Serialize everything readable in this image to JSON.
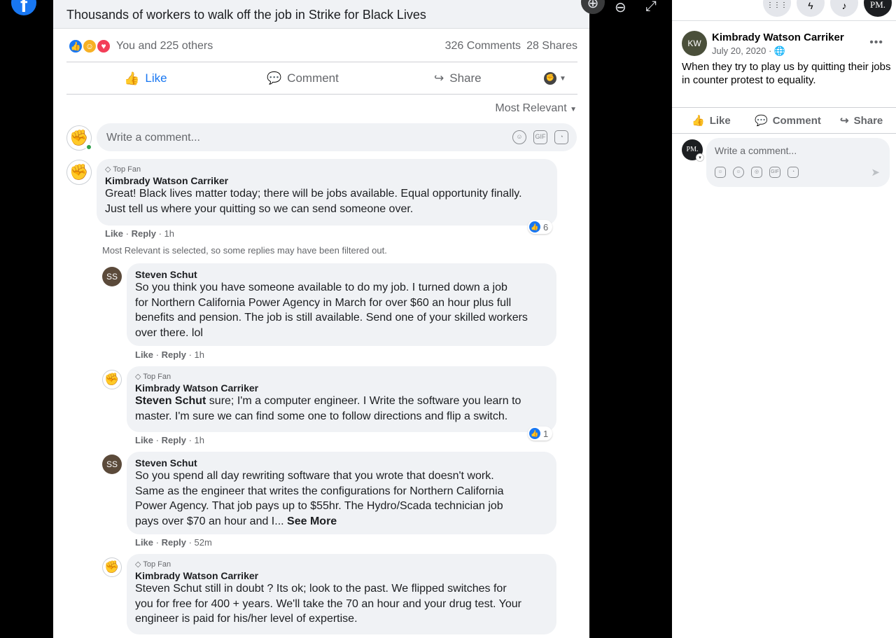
{
  "post": {
    "headline": "Thousands of workers to walk off the job in Strike for Black Lives",
    "reactions_text": "You and 225 others",
    "comments_count": "326 Comments",
    "shares_count": "28 Shares",
    "actions": {
      "like": "Like",
      "comment": "Comment",
      "share": "Share"
    },
    "sort_label": "Most Relevant",
    "write_placeholder": "Write a comment...",
    "filter_note": "Most Relevant is selected, so some replies may have been filtered out."
  },
  "comments": [
    {
      "badge": "Top Fan",
      "author": "Kimbrady Watson Carriker",
      "lines": [
        "Great! Black lives matter today; there will be jobs available. Equal opportunity finally.",
        "Just tell us where your quitting so we can send someone over."
      ],
      "like": "Like",
      "reply": "Reply",
      "time": "1h",
      "likes": "6"
    },
    {
      "author": "Steven Schut",
      "lines": [
        "So you think you have someone available to do my job. I turned down a job",
        "for Northern California Power Agency in March for over $60 an hour plus full",
        "benefits and pension. The job is still available. Send one of your skilled workers",
        "over there. lol"
      ],
      "like": "Like",
      "reply": "Reply",
      "time": "1h"
    },
    {
      "badge": "Top Fan",
      "author": "Kimbrady Watson Carriker",
      "mention": "Steven Schut",
      "lines": [
        " sure; I'm a computer engineer. I Write the software you learn to",
        "master. I'm sure we can find some one to follow directions and flip a switch."
      ],
      "like": "Like",
      "reply": "Reply",
      "time": "1h",
      "likes": "1"
    },
    {
      "author": "Steven Schut",
      "lines": [
        "So you spend all day rewriting software that you wrote that doesn't work.",
        "Same as the engineer that writes the configurations for Northern California",
        "Power Agency. That job pays up to $55hr. The Hydro/Scada technician job",
        "pays over $70 an hour and I..."
      ],
      "see_more": "See More",
      "like": "Like",
      "reply": "Reply",
      "time": "52m"
    },
    {
      "badge": "Top Fan",
      "author": "Kimbrady Watson Carriker",
      "lines": [
        "Steven Schut still in doubt ? Its ok; look to the past. We flipped switches for",
        "you for free for 400 + years. We'll take the 70 an hour and your drug test. Your",
        "engineer is paid for his/her level of expertise."
      ]
    }
  ],
  "panel": {
    "author": "Kimbrady Watson Carriker",
    "date": "July 20, 2020 · ",
    "text": "When they try to play us by quitting their jobs in counter protest to equality.",
    "actions": {
      "like": "Like",
      "comment": "Comment",
      "share": "Share"
    },
    "write_placeholder": "Write a comment...",
    "me_initials": "PM."
  },
  "icons": {
    "fb_logo": "f",
    "zoom_in": "⊕",
    "zoom_out": "⊖",
    "fullscreen": "⤢",
    "more": "•••",
    "send": "➤",
    "apps": "⋮⋮⋮",
    "messenger": "ϟ",
    "bell": "♪"
  },
  "colors": {
    "brand_blue": "#1877f2",
    "bubble_bg": "#f0f2f5",
    "muted": "#65676b"
  }
}
